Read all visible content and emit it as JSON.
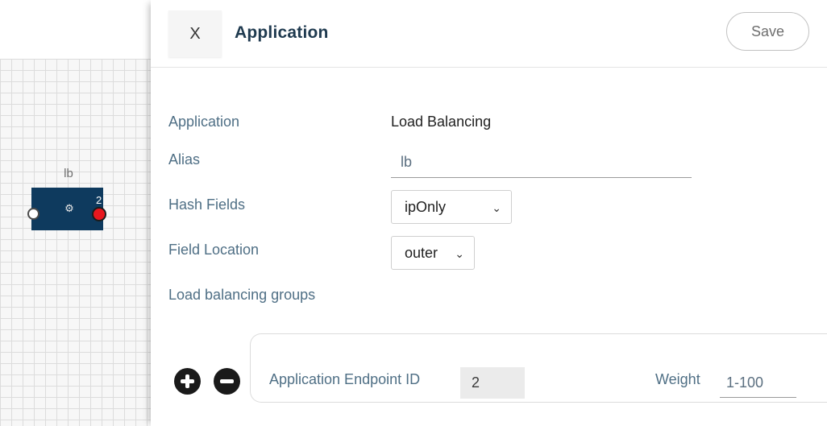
{
  "canvas": {
    "node": {
      "label": "lb",
      "icon": "gear-icon",
      "count": "2",
      "color": "#0e3a5e",
      "output_port_color": "#e8171e"
    }
  },
  "panel": {
    "close_label": "X",
    "title": "Application",
    "save_label": "Save",
    "fields": {
      "application_label": "Application",
      "application_value": "Load Balancing",
      "alias_label": "Alias",
      "alias_value": "lb",
      "hash_fields_label": "Hash Fields",
      "hash_fields_value": "ipOnly",
      "field_location_label": "Field Location",
      "field_location_value": "outer",
      "groups_label": "Load balancing groups"
    },
    "group_row": {
      "add_icon": "plus-circle-icon",
      "remove_icon": "minus-circle-icon",
      "endpoint_label": "Application Endpoint ID",
      "endpoint_value": "2",
      "weight_label": "Weight",
      "weight_placeholder": "1-100"
    }
  },
  "colors": {
    "label_text": "#4f6f85",
    "title_text": "#1f3a4f"
  }
}
